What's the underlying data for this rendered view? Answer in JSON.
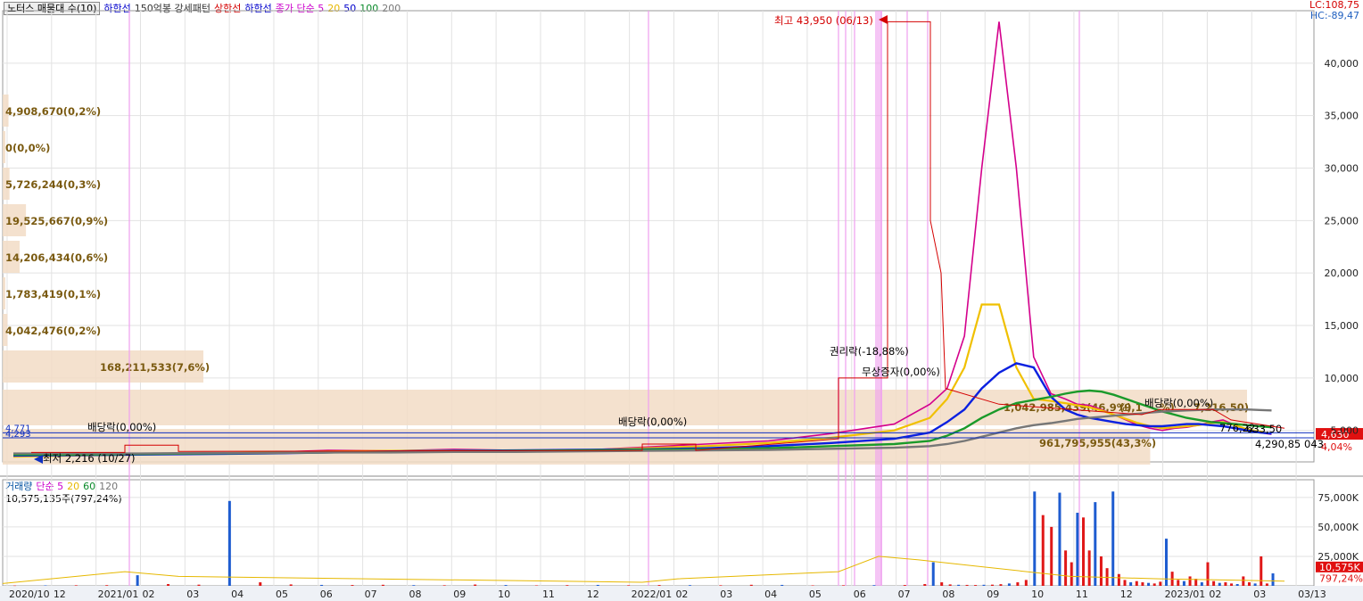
{
  "top_legend": [
    {
      "text": "노터스 매물대 수(10)",
      "color": "#000000",
      "boxed": true
    },
    {
      "text": "하한선",
      "color": "#0000cc"
    },
    {
      "text": "150억봉 강세패턴",
      "color": "#333333"
    },
    {
      "text": "상한선",
      "color": "#d40000"
    },
    {
      "text": "하한선",
      "color": "#0000cc"
    },
    {
      "text": "종가 단순 5",
      "color": "#cc00cc"
    },
    {
      "text": "20",
      "color": "#e6b800"
    },
    {
      "text": "50",
      "color": "#0000cc"
    },
    {
      "text": "100",
      "color": "#0a8a2a"
    },
    {
      "text": "200",
      "color": "#777777"
    }
  ],
  "corner": {
    "lc": "LC:108,75",
    "hc": "HC:-89,47"
  },
  "volume_legend": {
    "items": [
      {
        "text": "거래량",
        "color": "#0050a0"
      },
      {
        "text": "단순 5",
        "color": "#cc00cc"
      },
      {
        "text": "20",
        "color": "#e6b800"
      },
      {
        "text": "60",
        "color": "#0a8a2a"
      },
      {
        "text": "120",
        "color": "#777777"
      }
    ],
    "value": "10,575,135주(797,24%)"
  },
  "chart_data": [
    {
      "type": "line",
      "title": "",
      "y_ticks": [
        "40,000",
        "35,000",
        "30,000",
        "25,000",
        "20,000",
        "15,000",
        "10,000",
        "5,000"
      ],
      "ylim": [
        2000,
        45000
      ],
      "x_ticks": [
        "2020/10",
        "12",
        "2021/01",
        "02",
        "03",
        "04",
        "05",
        "06",
        "07",
        "08",
        "09",
        "10",
        "11",
        "12",
        "2022/01",
        "02",
        "03",
        "04",
        "05",
        "06",
        "07",
        "08",
        "09",
        "10",
        "11",
        "12",
        "2023/01",
        "02",
        "03",
        "03/13"
      ],
      "current_price": "4,630",
      "current_change": "4,04%",
      "left_markers": [
        "4,771",
        "4,293"
      ],
      "annotations": [
        {
          "text": "최고 43,950 (06/13)",
          "color": "#d40000"
        },
        {
          "text": "최저 2,216 (10/27)",
          "color": "#000000"
        },
        {
          "text": "배당락(0,00%)",
          "color": "#000000"
        },
        {
          "text": "배당락(0,00%)",
          "color": "#000000"
        },
        {
          "text": "권리락(-18,88%)",
          "color": "#000000"
        },
        {
          "text": "무상증자(0,00%)",
          "color": "#000000"
        },
        {
          "text": "배당락(0,00%)",
          "color": "#000000"
        },
        {
          "text": "776,22",
          "color": "#000000"
        },
        {
          "text": "633,50",
          "color": "#000000"
        },
        {
          "text": "4,290,85",
          "color": "#000000"
        },
        {
          "text": "043,",
          "color": "#000000"
        }
      ],
      "volume_profile": [
        {
          "label": "4,908,670(0,2%)",
          "value": 4908670
        },
        {
          "label": "0(0,0%)",
          "value": 0
        },
        {
          "label": "5,726,244(0,3%)",
          "value": 5726244
        },
        {
          "label": "19,525,667(0,9%)",
          "value": 19525667
        },
        {
          "label": "14,206,434(0,6%)",
          "value": 14206434
        },
        {
          "label": "1,783,419(0,1%)",
          "value": 1783419
        },
        {
          "label": "4,042,476(0,2%)",
          "value": 4042476
        },
        {
          "label": "168,211,533(7,6%)",
          "value": 168211533
        },
        {
          "label": "1,042,985,439(46,9%)",
          "value": 1042985439
        },
        {
          "label": "961,795,955(43,3%)",
          "value": 961795955
        }
      ],
      "overlay_labels": [
        "(9,1",
        "%)",
        "7,216,50)"
      ],
      "series": [
        {
          "values": [
            2500,
            2600,
            2700,
            2800,
            2900,
            3100,
            3050,
            3200,
            3100,
            3100,
            3400,
            3700,
            4000,
            4700,
            5600,
            7500,
            9000,
            14000,
            30000,
            43950,
            30000,
            12000,
            8500,
            8000,
            7500,
            7400,
            7000,
            6500,
            6000,
            5500,
            5200,
            5000,
            5200,
            5300,
            5500,
            5800,
            6000,
            5500,
            5000,
            4800,
            4630
          ]
        },
        {
          "values": [
            2500,
            2600,
            2700,
            2800,
            2900,
            3000,
            3050,
            3100,
            3100,
            3100,
            3300,
            3500,
            3800,
            4300,
            5000,
            6200,
            8000,
            11000,
            17000,
            17000,
            11000,
            8000,
            7800,
            7600,
            7400,
            7200,
            6900,
            6500,
            6100,
            5700,
            5400,
            5200,
            5300,
            5400,
            5500,
            5700,
            5800,
            5500,
            5100,
            4900,
            4700
          ]
        },
        {
          "values": [
            2600,
            2650,
            2700,
            2750,
            2800,
            2900,
            3000,
            3050,
            3100,
            3150,
            3200,
            3300,
            3500,
            3800,
            4200,
            4800,
            5800,
            7000,
            9000,
            10500,
            11400,
            11000,
            8200,
            7000,
            6500,
            6200,
            6000,
            5800,
            5600,
            5500,
            5400,
            5400,
            5500,
            5600,
            5600,
            5500,
            5400,
            5200,
            5000,
            4800,
            4700
          ]
        },
        {
          "values": [
            2700,
            2700,
            2750,
            2800,
            2850,
            2900,
            2950,
            3000,
            3050,
            3100,
            3150,
            3200,
            3300,
            3500,
            3700,
            4000,
            4500,
            5200,
            6200,
            7000,
            7600,
            7900,
            8200,
            8500,
            8700,
            8800,
            8700,
            8400,
            8000,
            7600,
            7200,
            6800,
            6500,
            6200,
            6000,
            5800,
            5700,
            5600,
            5500,
            5400,
            5300
          ]
        },
        {
          "values": [
            2800,
            2800,
            2800,
            2850,
            2850,
            2900,
            2900,
            2950,
            2950,
            3000,
            3050,
            3100,
            3150,
            3250,
            3350,
            3500,
            3700,
            4000,
            4400,
            4800,
            5200,
            5500,
            5700,
            5900,
            6100,
            6200,
            6300,
            6400,
            6500,
            6600,
            6700,
            6800,
            6850,
            6900,
            6950,
            7000,
            7000,
            7000,
            7000,
            6950,
            6900
          ]
        }
      ]
    },
    {
      "type": "bar",
      "title": "",
      "y_ticks": [
        "75,000K",
        "50,000K",
        "25,000K"
      ],
      "ylim": [
        0,
        90000
      ],
      "current_value": "10,575K",
      "current_ratio": "797,24%",
      "values": [
        300,
        400,
        500,
        600,
        9000,
        1500,
        1000,
        72000,
        3000,
        1200,
        800,
        700,
        900,
        600,
        500,
        1100,
        700,
        400,
        600,
        800,
        500,
        700,
        600,
        500,
        900,
        800,
        400,
        500,
        600,
        700,
        1500,
        20000,
        3000,
        1200,
        900,
        800,
        700,
        900,
        1000,
        1400,
        2000,
        3000,
        5000,
        80000,
        60000,
        50000,
        79000,
        30000,
        20000,
        62000,
        58000,
        30000,
        71000,
        25000,
        15000,
        80000,
        10000,
        5000,
        3000,
        4000,
        3000,
        2500,
        2000,
        3500,
        40000,
        12000,
        5000,
        4000,
        8000,
        6000,
        3000,
        20000,
        4000,
        2500,
        3000,
        2000,
        1500,
        8000,
        3000,
        2000,
        25000,
        2000,
        10575
      ]
    }
  ]
}
